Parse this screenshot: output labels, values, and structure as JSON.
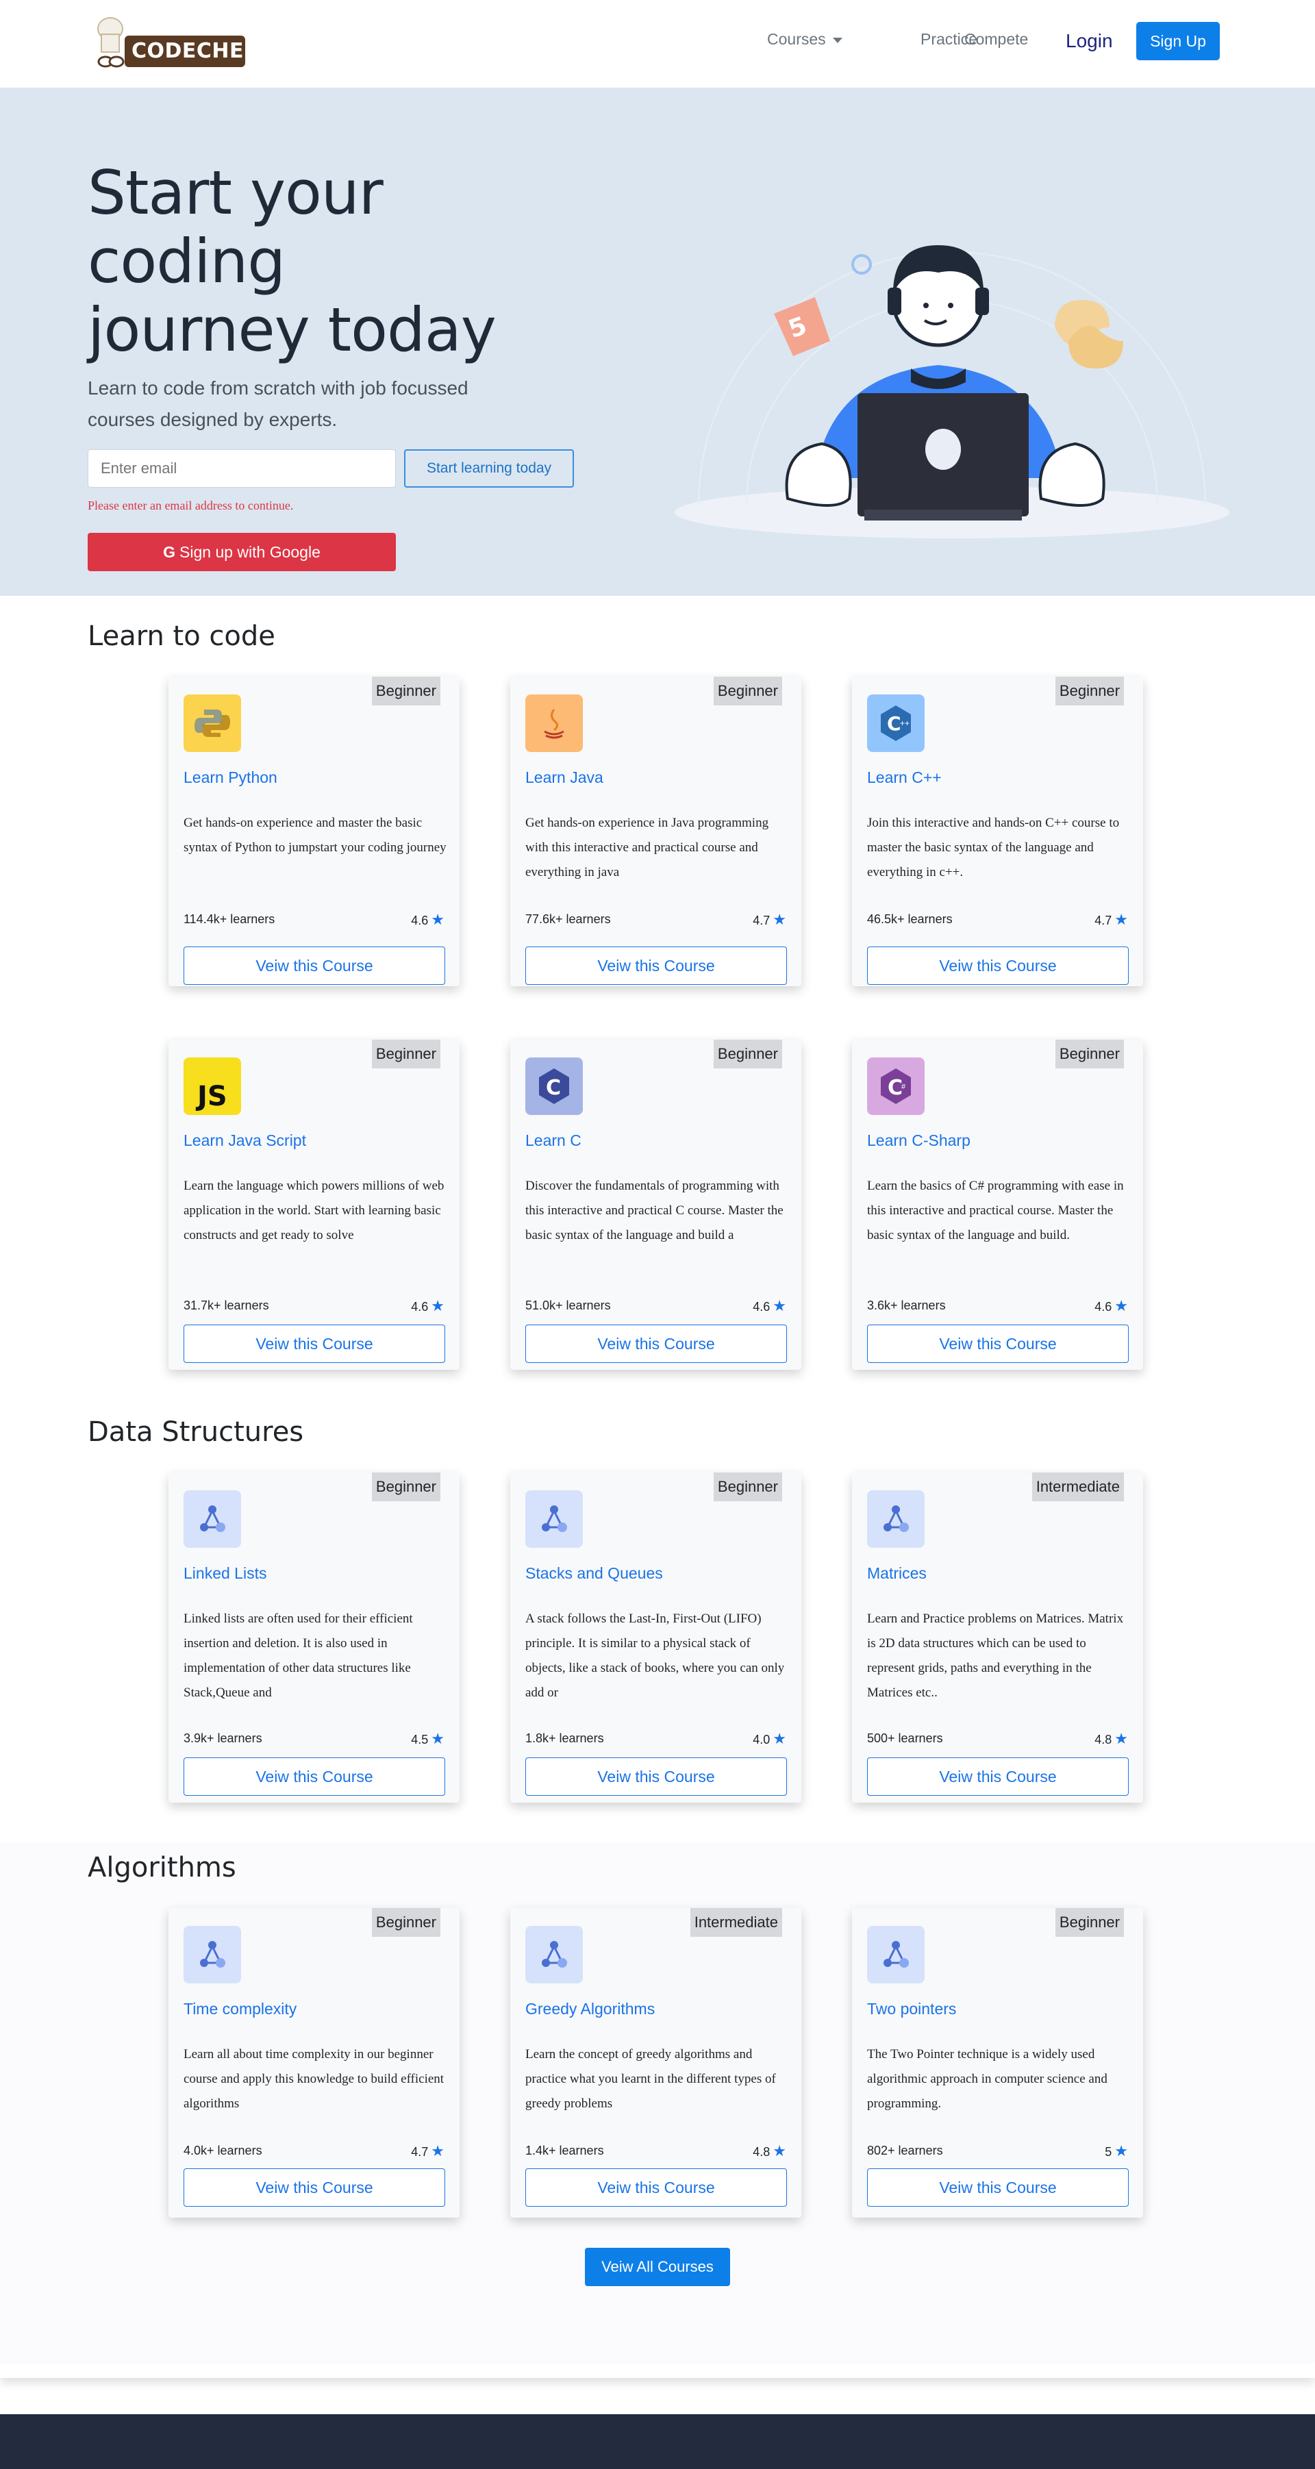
{
  "nav": {
    "logo_text": "CODECHEF",
    "courses_label": "Courses",
    "practice_label": "Practice",
    "compete_label": "Compete",
    "login_label": "Login",
    "signup_label": "Sign Up"
  },
  "hero": {
    "title": "Start your coding journey today",
    "subtitle": "Learn to code from scratch with job focussed courses designed by experts.",
    "email_placeholder": "Enter email",
    "start_button": "Start learning today",
    "error_text": "Please enter an email address to continue.",
    "google_button": "Sign up with Google"
  },
  "sections": {
    "learn": {
      "title": "Learn to code",
      "cards": [
        {
          "badge": "Beginner",
          "title": "Learn Python",
          "desc": "Get hands-on experience and master the basic syntax of Python to jumpstart your coding journey",
          "learners": "114.4k+ learners",
          "rating": "4.6",
          "button": "Veiw this Course",
          "icon": "python-icon",
          "icon_color": "#fcd34d"
        },
        {
          "badge": "Beginner",
          "title": "Learn Java",
          "desc": "Get hands-on experience in Java programming with this interactive and practical course and everything in java",
          "learners": "77.6k+ learners",
          "rating": "4.7",
          "button": "Veiw this Course",
          "icon": "java-icon",
          "icon_color": "#fdba74"
        },
        {
          "badge": "Beginner",
          "title": "Learn C++",
          "desc": "Join this interactive and hands-on C++ course to master the basic syntax of the language and everything in c++.",
          "learners": "46.5k+ learners",
          "rating": "4.7",
          "button": "Veiw this Course",
          "icon": "cpp-icon",
          "icon_color": "#93c5fd"
        },
        {
          "badge": "Beginner",
          "title": "Learn Java Script",
          "desc": "Learn the language which powers millions of web application in the world. Start with learning basic constructs and get ready to solve",
          "learners": "31.7k+ learners",
          "rating": "4.6",
          "button": "Veiw this Course",
          "icon": "javascript-icon",
          "icon_color": "#f7df1e"
        },
        {
          "badge": "Beginner",
          "title": "Learn C",
          "desc": "Discover the fundamentals of programming with this interactive and practical C course. Master the basic syntax of the language and build a",
          "learners": "51.0k+ learners",
          "rating": "4.6",
          "button": "Veiw this Course",
          "icon": "c-icon",
          "icon_color": "#a5b4e6"
        },
        {
          "badge": "Beginner",
          "title": "Learn C-Sharp",
          "desc": "Learn the basics of C# programming with ease in this interactive and practical course. Master the basic syntax of the language and build.",
          "learners": "3.6k+ learners",
          "rating": "4.6",
          "button": "Veiw this Course",
          "icon": "csharp-icon",
          "icon_color": "#d8a8e0"
        }
      ]
    },
    "ds": {
      "title": "Data Structures",
      "cards": [
        {
          "badge": "Beginner",
          "title": "Linked Lists",
          "desc": "Linked lists are often used for their efficient insertion and deletion. It is also used in implementation of other data structures like Stack,Queue and",
          "learners": "3.9k+ learners",
          "rating": "4.5",
          "button": "Veiw this Course",
          "icon": "tree-icon",
          "icon_color": "#d6e2fb"
        },
        {
          "badge": "Beginner",
          "title": "Stacks and Queues",
          "desc": "A stack follows the Last-In, First-Out (LIFO) principle. It is similar to a physical stack of objects, like a stack of books, where you can only add or",
          "learners": "1.8k+ learners",
          "rating": "4.0",
          "button": "Veiw this Course",
          "icon": "tree-icon",
          "icon_color": "#d6e2fb"
        },
        {
          "badge": "Intermediate",
          "title": "Matrices",
          "desc": "Learn and Practice problems on Matrices. Matrix is 2D data structures which can be used to represent grids, paths and everything in the Matrices etc..",
          "learners": "500+ learners",
          "rating": "4.8",
          "button": "Veiw this Course",
          "icon": "tree-icon",
          "icon_color": "#d6e2fb"
        }
      ]
    },
    "algo": {
      "title": "Algorithms",
      "cards": [
        {
          "badge": "Beginner",
          "title": "Time complexity",
          "desc": "Learn all about time complexity in our beginner course and apply this knowledge to build efficient algorithms",
          "learners": "4.0k+ learners",
          "rating": "4.7",
          "button": "Veiw this Course",
          "icon": "tree-icon",
          "icon_color": "#d6e2fb"
        },
        {
          "badge": "Intermediate",
          "title": "Greedy Algorithms",
          "desc": "Learn the concept of greedy algorithms and practice what you learnt in the different types of greedy problems",
          "learners": "1.4k+ learners",
          "rating": "4.8",
          "button": "Veiw this Course",
          "icon": "tree-icon",
          "icon_color": "#d6e2fb"
        },
        {
          "badge": "Beginner",
          "title": "Two pointers",
          "desc": "The Two Pointer technique is a widely used algorithmic approach in computer science and programming.",
          "learners": "802+ learners",
          "rating": "5",
          "button": "Veiw this Course",
          "icon": "tree-icon",
          "icon_color": "#d6e2fb"
        }
      ]
    }
  },
  "view_all_button": "Veiw All Courses",
  "colors": {
    "accent": "#0d7fe8",
    "hero_bg": "#dce6f0",
    "danger": "#dc3545",
    "footer": "#232b3e"
  }
}
